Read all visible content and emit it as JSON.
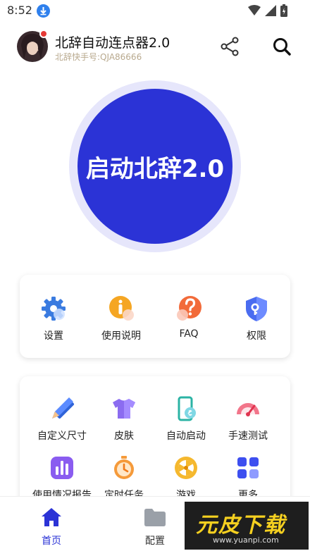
{
  "status_bar": {
    "time": "8:52"
  },
  "header": {
    "title": "北辞自动连点器2.0",
    "subtitle": "北辞快手号:QJA86666"
  },
  "start_button": {
    "label": "启动北辞2.0"
  },
  "quick_actions": [
    {
      "label": "设置",
      "icon": "gear-icon"
    },
    {
      "label": "使用说明",
      "icon": "info-icon"
    },
    {
      "label": "FAQ",
      "icon": "question-icon"
    },
    {
      "label": "权限",
      "icon": "shield-icon"
    }
  ],
  "tools": [
    {
      "label": "自定义尺寸",
      "icon": "ruler-pencil-icon"
    },
    {
      "label": "皮肤",
      "icon": "tshirt-icon"
    },
    {
      "label": "自动启动",
      "icon": "phone-link-icon"
    },
    {
      "label": "手速测试",
      "icon": "speedometer-icon"
    },
    {
      "label": "使用情况报告",
      "icon": "bar-chart-icon"
    },
    {
      "label": "定时任务",
      "icon": "stopwatch-icon"
    },
    {
      "label": "游戏",
      "icon": "wheel-icon"
    },
    {
      "label": "更多",
      "icon": "grid-icon"
    }
  ],
  "bottom_nav": [
    {
      "label": "首页",
      "icon": "home-icon"
    },
    {
      "label": "配置",
      "icon": "folder-icon"
    }
  ],
  "watermark": {
    "text": "元皮下载",
    "url": "www.yuanpi.com"
  },
  "colors": {
    "primary": "#2b33d6",
    "ring": "#e6e6fb",
    "nav_active": "#2b33d6",
    "subtitle": "#b8a98e"
  }
}
